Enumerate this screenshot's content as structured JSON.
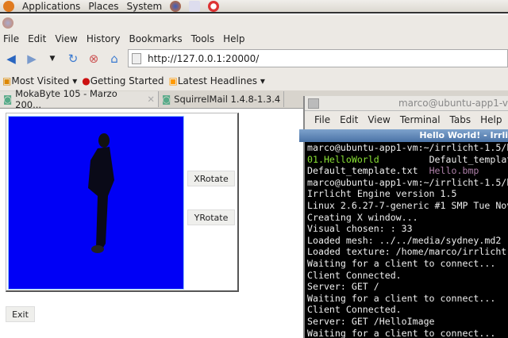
{
  "panel": {
    "items": [
      "Applications",
      "Places",
      "System"
    ]
  },
  "firefox": {
    "menu": [
      "File",
      "Edit",
      "View",
      "History",
      "Bookmarks",
      "Tools",
      "Help"
    ],
    "url": "http://127.0.0.1:20000/",
    "bookmarks": [
      "Most Visited",
      "Getting Started",
      "Latest Headlines"
    ],
    "tabs": [
      "MokaByte 105 - Marzo 200...",
      "SquirrelMail 1.4.8-1.3.4"
    ]
  },
  "page": {
    "xrotate": "XRotate",
    "yrotate": "YRotate",
    "exit": "Exit"
  },
  "terminal": {
    "title": "marco@ubuntu-app1-v",
    "menu": [
      "File",
      "Edit",
      "View",
      "Terminal",
      "Tabs",
      "Help"
    ],
    "app_title": "Hello World! - Irrli",
    "lines": [
      "marco@ubuntu-app1-vm:~/irrlicht-1.5/b",
      "01.HelloWorld",
      "Default_templat",
      "Default_template.txt",
      "Hello.bmp",
      "marco@ubuntu-app1-vm:~/irrlicht-1.5/b",
      "Irrlicht Engine version 1.5",
      "Linux 2.6.27-7-generic #1 SMP Tue Nov",
      "Creating X window...",
      "Visual chosen: : 33",
      "Loaded mesh: ../../media/sydney.md2",
      "Loaded texture: /home/marco/irrlicht-",
      "Waiting for a client to connect...",
      "Client Connected.",
      "Server: GET /",
      "Waiting for a client to connect...",
      "Client Connected.",
      "Server: GET /HelloImage",
      "Waiting for a client to connect..."
    ]
  }
}
